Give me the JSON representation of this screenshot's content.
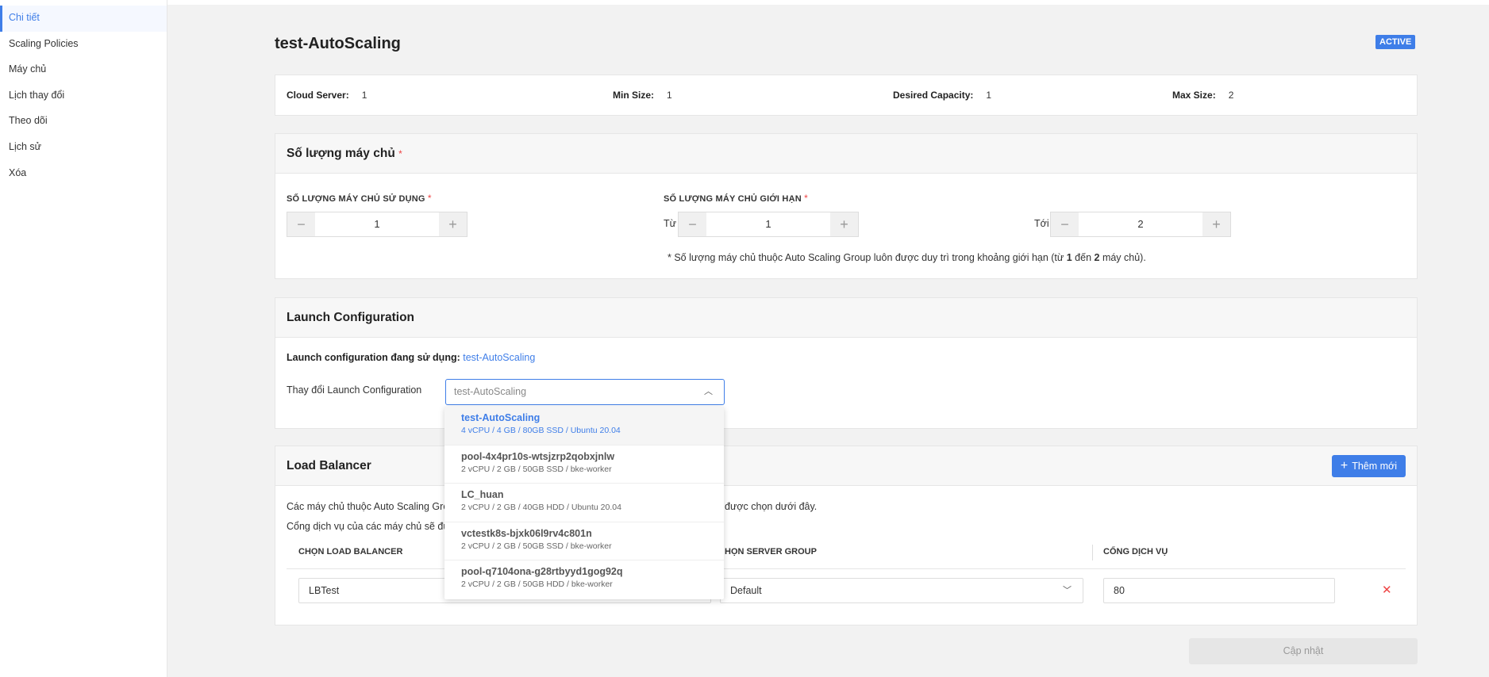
{
  "sidebar": {
    "items": [
      {
        "label": "Chi tiết"
      },
      {
        "label": "Scaling Policies"
      },
      {
        "label": "Máy chủ"
      },
      {
        "label": "Lịch thay đổi"
      },
      {
        "label": "Theo dõi"
      },
      {
        "label": "Lịch sử"
      },
      {
        "label": "Xóa"
      }
    ]
  },
  "page": {
    "title": "test-AutoScaling",
    "status": "ACTIVE"
  },
  "summary": {
    "cloud_server_label": "Cloud Server:",
    "cloud_server": "1",
    "min_size_label": "Min Size:",
    "min_size": "1",
    "desired_label": "Desired Capacity:",
    "desired": "1",
    "max_size_label": "Max Size:",
    "max_size": "2"
  },
  "quantity": {
    "title": "Số lượng máy chủ",
    "used_label": "SỐ LƯỢNG MÁY CHỦ SỬ DỤNG",
    "used_value": "1",
    "limit_label": "SỐ LƯỢNG MÁY CHỦ GIỚI HẠN",
    "from_label": "Từ",
    "from_value": "1",
    "to_label": "Tới",
    "to_value": "2",
    "note_prefix": "* Số lượng máy chủ thuộc Auto Scaling Group luôn được duy trì trong khoảng giới hạn (từ ",
    "note_min": "1",
    "note_mid": " đến ",
    "note_max": "2",
    "note_suffix": " máy chủ)."
  },
  "launch_config": {
    "title": "Launch Configuration",
    "current_label": "Launch configuration đang sử dụng:",
    "current_value": "test-AutoScaling",
    "change_label": "Thay đổi Launch Configuration",
    "select_value": "test-AutoScaling",
    "options": [
      {
        "name": "test-AutoScaling",
        "spec": "4 vCPU / 4 GB / 80GB SSD / Ubuntu 20.04"
      },
      {
        "name": "pool-4x4pr10s-wtsjzrp2qobxjnlw",
        "spec": "2 vCPU / 2 GB / 50GB SSD / bke-worker"
      },
      {
        "name": "LC_huan",
        "spec": "2 vCPU / 2 GB / 40GB HDD / Ubuntu 20.04"
      },
      {
        "name": "vctestk8s-bjxk06l9rv4c801n",
        "spec": "2 vCPU / 2 GB / 50GB SSD / bke-worker"
      },
      {
        "name": "pool-q7104ona-g28rtbyyd1gog92q",
        "spec": "2 vCPU / 2 GB / 50GB HDD / bke-worker"
      }
    ]
  },
  "load_balancer": {
    "title": "Load Balancer",
    "add_label": "Thêm mới",
    "desc1_left": "Các máy chủ thuộc Auto Scaling Gro",
    "desc1_right": "được chọn dưới đây.",
    "desc2_left": "Cổng dịch vụ của các máy chủ sẽ đư",
    "col_lb": "CHỌN LOAD BALANCER",
    "col_sg": "HỌN SERVER GROUP",
    "col_port": "CỔNG DỊCH VỤ",
    "lb_value": "LBTest",
    "sg_value": "Default",
    "port_value": "80"
  },
  "update_label": "Cập nhật"
}
